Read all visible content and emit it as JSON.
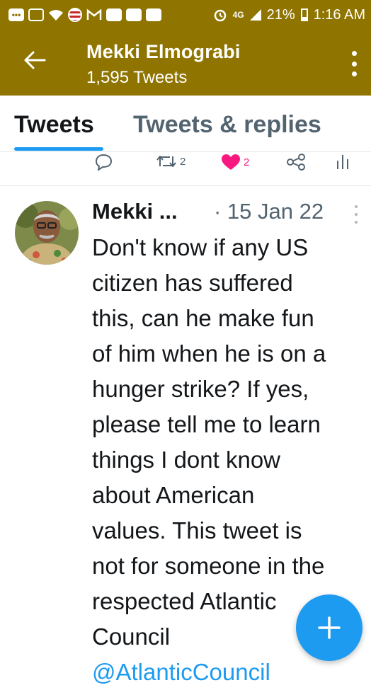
{
  "status_bar": {
    "icons": [
      "more-notifications-icon",
      "image-icon",
      "wifi-icon",
      "flag-icon",
      "gmail-icon",
      "flipboard-icon",
      "youtube-icon",
      "youtube-icon",
      "alarm-icon",
      "4g-lte-icon",
      "signal-icon",
      "battery-icon"
    ],
    "more_glyph": "•••",
    "network": "4G",
    "battery": "21%",
    "time": "1:16 AM"
  },
  "header": {
    "name": "Mekki Elmograbi",
    "tweet_count": "1,595 Tweets",
    "background_color": "#8f7500"
  },
  "tabs": [
    {
      "label": "Tweets",
      "active": true
    },
    {
      "label": "Tweets & replies",
      "active": false
    }
  ],
  "prev_actions": {
    "retweets": "2",
    "likes": "2"
  },
  "tweet": {
    "author": "Mekki ...",
    "date": "· 15 Jan 22",
    "lines": [
      "Don't know if any US",
      "citizen has suffered",
      "this, can he make fun",
      "of him when he is on a",
      "hunger strike? If yes,",
      "please tell me to learn",
      "things I dont know",
      "about American",
      "values. This tweet is",
      "not for someone in the",
      "respected Atlantic",
      "Council"
    ],
    "mention": "@AtlanticCouncil"
  },
  "fab": {
    "label": "+",
    "icon": "compose-plus-icon",
    "color": "#1d9bf0"
  },
  "colors": {
    "accent": "#1d9bf0",
    "like": "#f91880",
    "muted": "#536471"
  }
}
